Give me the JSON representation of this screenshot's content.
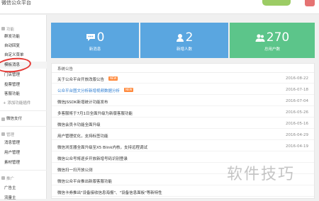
{
  "topbar": {
    "brand": "微信公众平台"
  },
  "sidebar": {
    "sections": [
      {
        "title": "功能",
        "items": [
          "群发功能",
          "自动回复",
          "自定义菜单",
          "模板消息",
          "门店管理",
          "投票管理",
          "客服功能"
        ],
        "add": "+ 添加功能插件"
      },
      {
        "title": "",
        "items": [
          "微信支付"
        ]
      },
      {
        "title": "管理",
        "items": [
          "消息管理",
          "用户管理",
          "素材管理"
        ]
      },
      {
        "title": "推广",
        "items": [
          "广告主",
          "流量主"
        ]
      }
    ]
  },
  "stats": [
    {
      "value": "0",
      "label": "新消息",
      "icon": "message-icon"
    },
    {
      "value": "2",
      "label": "新增人数",
      "icon": "user-icon"
    },
    {
      "value": "270",
      "label": "总用户数",
      "icon": "users-icon"
    }
  ],
  "announcements": {
    "title": "系统公告",
    "rows": [
      {
        "title": "关于公众平台开放改版公告",
        "date": "2016-08-22",
        "badge": "NEW",
        "link": false
      },
      {
        "title": "公众平台图文分析新增视频数据分析",
        "date": "2016-07-18",
        "badge": "NEW",
        "link": true
      },
      {
        "title": "微信JSSDK新增统计功能发布",
        "date": "2016-07-04",
        "badge": "",
        "link": false
      },
      {
        "title": "多客服将于7月1日全面升级为新版客服功能",
        "date": "2016-05-26",
        "badge": "",
        "link": false
      },
      {
        "title": "微信会员卡功能全面升级",
        "date": "2016-05-16",
        "badge": "",
        "link": false
      },
      {
        "title": "用户管理优化，支持标签功能",
        "date": "2016-04-29",
        "badge": "",
        "link": false
      },
      {
        "title": "微信浏览器全面升级至X5 Blink内核，支持远程调试",
        "date": "2016-04-19",
        "badge": "",
        "link": false
      },
      {
        "title": "微信公众号将逐步开放新增号码识别登录",
        "date": "",
        "badge": "",
        "link": false
      },
      {
        "title": "微信扫一扫开放公测",
        "date": "",
        "badge": "",
        "link": false
      },
      {
        "title": "微信公众平台推出新版客服功能",
        "date": "",
        "badge": "",
        "link": false
      },
      {
        "title": "微信卡券推出\"设备接收信息海报\"、\"设备信息面板\"等新特性",
        "date": "",
        "badge": "",
        "link": false
      }
    ]
  },
  "watermark": "软件技巧"
}
